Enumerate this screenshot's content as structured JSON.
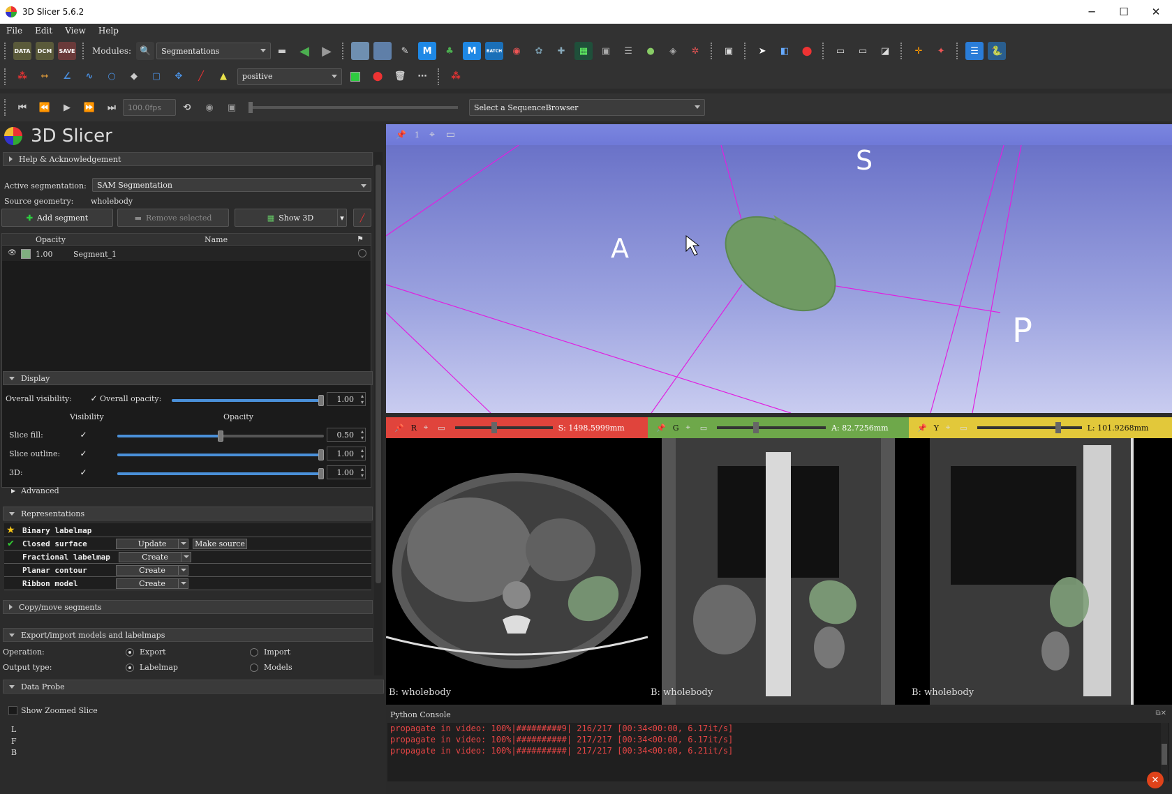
{
  "window": {
    "title": "3D Slicer 5.6.2"
  },
  "menu": [
    "File",
    "Edit",
    "View",
    "Help"
  ],
  "toolbar1": {
    "data_label": "DATA",
    "dcm_label": "DCM",
    "save_label": "SAVE",
    "modules_label": "Modules:",
    "module_selected": "Segmentations"
  },
  "toolbar2": {
    "label_combo": "positive"
  },
  "toolbar3": {
    "fps": "100.0fps",
    "sequence_browser": "Select a SequenceBrowser"
  },
  "module_header": "3D Slicer",
  "help_section": "Help & Acknowledgement",
  "segmentation": {
    "active_label": "Active segmentation:",
    "active_value": "SAM Segmentation",
    "source_label": "Source geometry:",
    "source_value": "wholebody",
    "add_segment": "Add segment",
    "remove_selected": "Remove selected",
    "show_3d": "Show 3D",
    "table_headers": {
      "opacity": "Opacity",
      "name": "Name"
    },
    "segments": [
      {
        "opacity": "1.00",
        "name": "Segment_1",
        "color": "#80ae80"
      }
    ]
  },
  "display": {
    "title": "Display",
    "overall_visibility": "Overall visibility:",
    "overall_opacity_label": "Overall opacity:",
    "overall_opacity": "1.00",
    "col_visibility": "Visibility",
    "col_opacity": "Opacity",
    "rows": [
      {
        "label": "Slice fill:",
        "value": "0.50",
        "level": 0.5
      },
      {
        "label": "Slice outline:",
        "value": "1.00",
        "level": 1.0
      },
      {
        "label": "3D:",
        "value": "1.00",
        "level": 1.0
      }
    ],
    "advanced": "Advanced"
  },
  "representations": {
    "title": "Representations",
    "rows": [
      {
        "name": "Binary labelmap",
        "icon": "star-icon"
      },
      {
        "name": "Closed surface",
        "icon": "check-icon",
        "button": "Update",
        "button2": "Make source"
      },
      {
        "name": "Fractional labelmap",
        "button": "Create"
      },
      {
        "name": "Planar contour",
        "button": "Create"
      },
      {
        "name": "Ribbon model",
        "button": "Create"
      }
    ]
  },
  "copy_move": "Copy/move segments",
  "export_import": {
    "title": "Export/import models and labelmaps",
    "operation_label": "Operation:",
    "export": "Export",
    "import": "Import",
    "output_label": "Output type:",
    "labelmap": "Labelmap",
    "models": "Models"
  },
  "data_probe": {
    "title": "Data Probe",
    "show_zoomed": "Show Zoomed Slice",
    "rows": [
      "L",
      "F",
      "B"
    ]
  },
  "view3d": {
    "index": "1",
    "labels": {
      "s": "S",
      "a": "A",
      "p": "P"
    }
  },
  "slices": [
    {
      "id": "R",
      "offset": "S: 1498.5999mm",
      "label": "B: wholebody",
      "color": "#e0443c"
    },
    {
      "id": "G",
      "offset": "A: 82.7256mm",
      "label": "B: wholebody",
      "color": "#6ea84a"
    },
    {
      "id": "Y",
      "offset": "L: 101.9268mm",
      "label": "B: wholebody",
      "color": "#e2c83a"
    }
  ],
  "console": {
    "title": "Python Console",
    "lines": [
      "propagate in video: 100%|#########9| 216/217 [00:34<00:00,  6.17it/s]",
      "propagate in video: 100%|##########| 217/217 [00:34<00:00,  6.17it/s]",
      "propagate in video: 100%|##########| 217/217 [00:34<00:00,  6.21it/s]"
    ]
  }
}
